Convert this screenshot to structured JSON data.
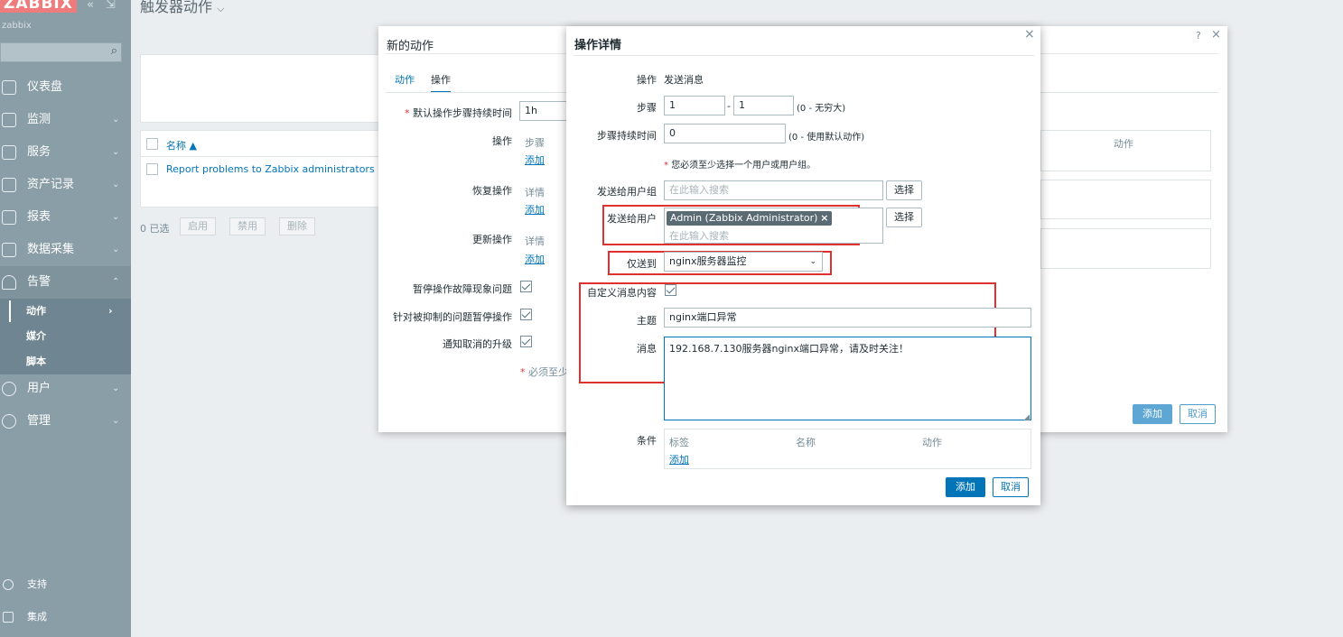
{
  "sidebar": {
    "logo": "ZABBIX",
    "server_name": "zabbix",
    "collapse_icon": "double-chevron-left-icon",
    "expand_icon": "expand-icon",
    "menu": [
      {
        "label": "仪表盘",
        "icon": "dashboard-icon",
        "has_sub": false
      },
      {
        "label": "监测",
        "icon": "monitoring-icon",
        "has_sub": true
      },
      {
        "label": "服务",
        "icon": "services-icon",
        "has_sub": true
      },
      {
        "label": "资产记录",
        "icon": "inventory-icon",
        "has_sub": true
      },
      {
        "label": "报表",
        "icon": "reports-icon",
        "has_sub": true
      },
      {
        "label": "数据采集",
        "icon": "data-collection-icon",
        "has_sub": true
      },
      {
        "label": "告警",
        "icon": "bell-icon",
        "has_sub": true,
        "expanded": true
      },
      {
        "label": "用户",
        "icon": "users-icon",
        "has_sub": true
      },
      {
        "label": "管理",
        "icon": "gear-icon",
        "has_sub": true
      }
    ],
    "alerts_submenu": [
      {
        "label": "动作",
        "current": true
      },
      {
        "label": "媒介"
      },
      {
        "label": "脚本"
      }
    ],
    "footer": [
      {
        "label": "支持",
        "icon": "headset-icon"
      },
      {
        "label": "集成",
        "icon": "integrations-icon"
      }
    ]
  },
  "page": {
    "title": "触发器动作",
    "table": {
      "name_header": "名称 ▲",
      "row_name": "Report problems to Zabbix administrators"
    },
    "selected_count": "0 已选",
    "mass_buttons": [
      "启用",
      "禁用",
      "删除"
    ]
  },
  "action_dialog": {
    "title": "新的动作",
    "help_icon": "?",
    "tabs": [
      "动作",
      "操作"
    ],
    "default_duration_label": "默认操作步骤持续时间",
    "default_duration_value": "1h",
    "operations_label": "操作",
    "operations_col": "步骤",
    "recovery_label": "恢复操作",
    "recovery_col": "详情",
    "update_label": "更新操作",
    "update_col": "详情",
    "add_link": "添加",
    "pause_symptoms_label": "暂停操作故障现象问题",
    "pause_suppressed_label": "针对被抑制的问题暂停操作",
    "notify_cancel_label": "通知取消的升级",
    "must_note": "必须至少",
    "right_col_header": "动作",
    "add_button": "添加",
    "cancel_button": "取消"
  },
  "op_dialog": {
    "title": "操作详情",
    "operation_label": "操作",
    "operation_value": "发送消息",
    "steps_label": "步骤",
    "step_from": "1",
    "step_to": "1",
    "step_hint": "(0 - 无穷大)",
    "step_duration_label": "步骤持续时间",
    "step_duration_value": "0",
    "step_duration_hint": "(0 - 使用默认动作)",
    "must_select_note": "您必须至少选择一个用户或用户组。",
    "send_groups_label": "发送给用户组",
    "search_placeholder": "在此输入搜索",
    "select_button": "选择",
    "send_users_label": "发送给用户",
    "user_tag": "Admin (Zabbix Administrator)",
    "send_only_to_label": "仅送到",
    "send_only_to_value": "nginx服务器监控",
    "custom_message_label": "自定义消息内容",
    "subject_label": "主题",
    "subject_value": "nginx端口异常",
    "message_label": "消息",
    "message_value": "192.168.7.130服务器nginx端口异常，请及时关注！",
    "conditions_label": "条件",
    "cond_cols": [
      "标签",
      "名称",
      "动作"
    ],
    "cond_add": "添加",
    "add_button": "添加",
    "cancel_button": "取消"
  },
  "colors": {
    "sidebar_bg": "#8a9ea8",
    "logo_bg": "#ee7c7c",
    "primary": "#0275b8",
    "highlight_box": "#e03131"
  }
}
